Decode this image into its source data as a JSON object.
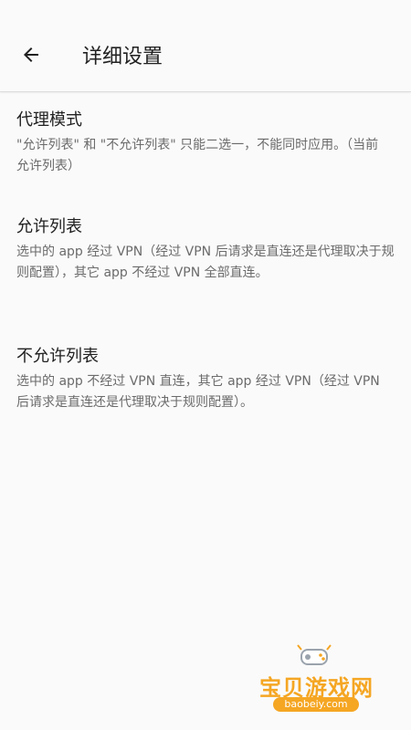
{
  "header": {
    "title": "详细设置",
    "back_icon": "arrow-back-icon"
  },
  "sections": [
    {
      "title": "代理模式",
      "description": "\"允许列表\" 和 \"不允许列表\" 只能二选一，不能同时应用。（当前 允许列表）"
    },
    {
      "title": "允许列表",
      "description": "选中的 app 经过 VPN（经过 VPN 后请求是直连还是代理取决于规则配置），其它 app 不经过 VPN 全部直连。"
    },
    {
      "title": "不允许列表",
      "description": "选中的 app 不经过 VPN 直连，其它 app 经过 VPN（经过 VPN 后请求是直连还是代理取决于规则配置）。"
    }
  ],
  "watermark": {
    "name": "宝贝游戏网",
    "url": "baobeiy.com",
    "icon": "gamepad-icon"
  },
  "colors": {
    "background": "#fafafa",
    "title_text": "#212121",
    "description_text": "#6b6b6b",
    "divider": "#dddddd",
    "watermark_accent": "#f5a623"
  }
}
